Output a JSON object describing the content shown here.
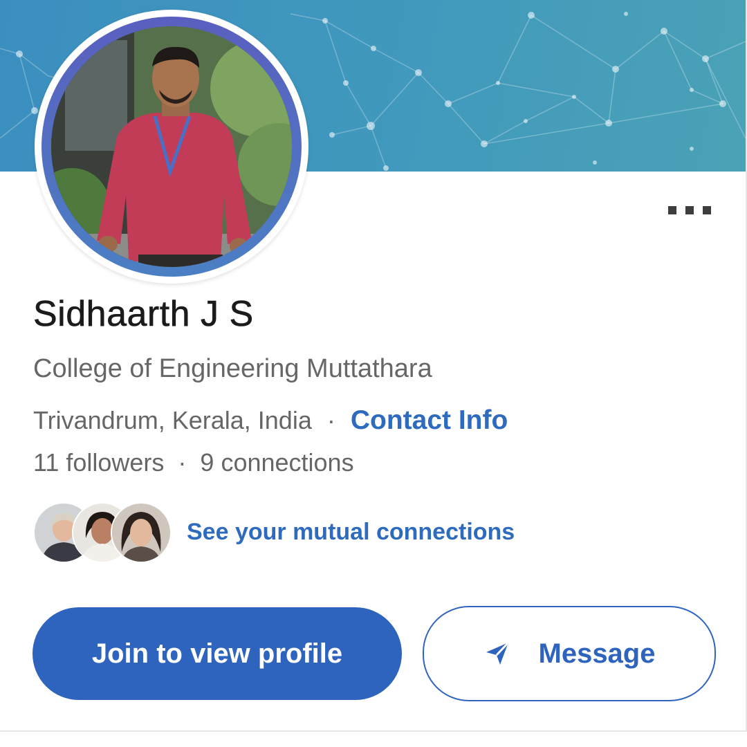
{
  "profile": {
    "name": "Sidhaarth J S",
    "headline": "College of Engineering Muttathara",
    "location": "Trivandrum, Kerala, India",
    "contact_info_label": "Contact Info",
    "followers": "11 followers",
    "connections": "9 connections",
    "separator": "·"
  },
  "mutual": {
    "link_label": "See your mutual connections",
    "avatars": [
      "mutual-avatar-1",
      "mutual-avatar-2",
      "mutual-avatar-3"
    ]
  },
  "actions": {
    "join_label": "Join to view profile",
    "message_label": "Message",
    "more_icon": "more-dots-icon",
    "message_icon": "send-icon"
  },
  "theme": {
    "banner_color": "#4199bd",
    "primary_blue": "#2e64be",
    "link_blue": "#2e6bbf",
    "text_dark": "#1b1b1b",
    "text_muted": "#666666"
  }
}
